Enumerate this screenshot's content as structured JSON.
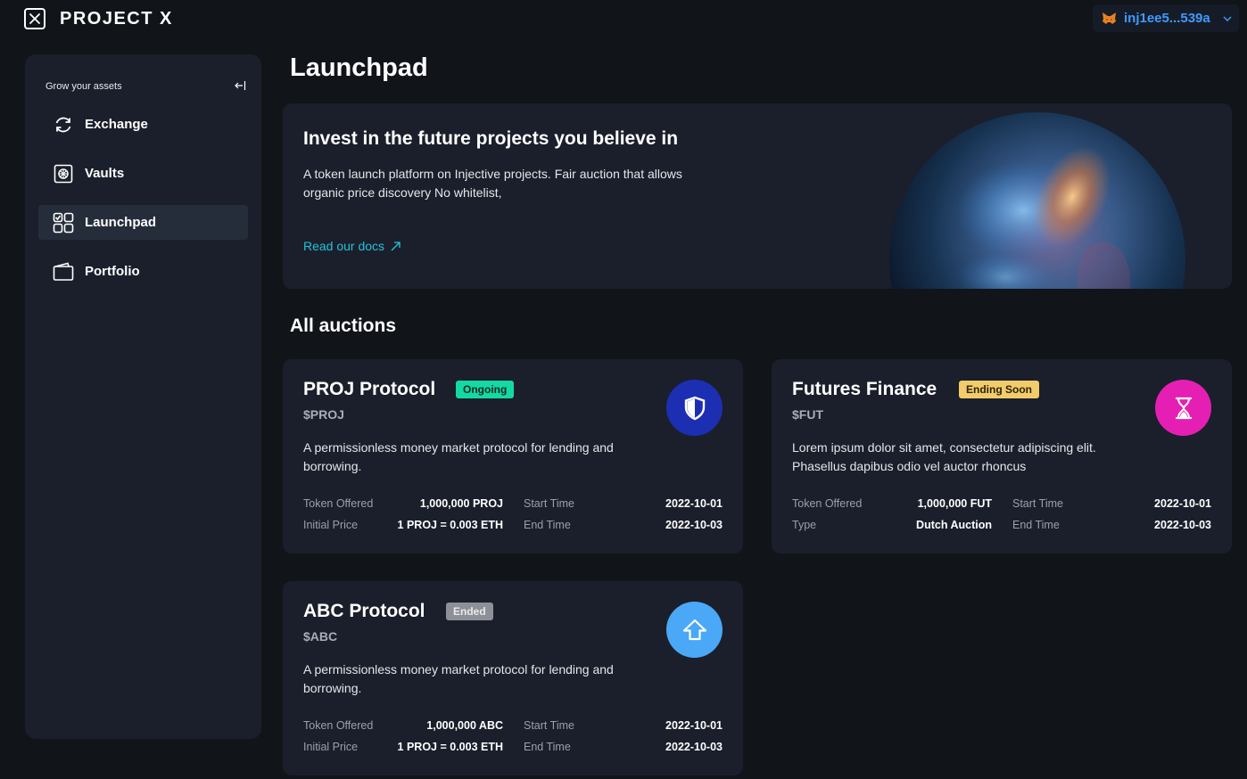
{
  "app": {
    "brand": "PROJECT X",
    "wallet_address": "inj1ee5...539a"
  },
  "sidebar": {
    "heading": "Grow your assets",
    "items": [
      {
        "label": "Exchange",
        "icon": "exchange-icon",
        "active": false
      },
      {
        "label": "Vaults",
        "icon": "vault-icon",
        "active": false
      },
      {
        "label": "Launchpad",
        "icon": "launchpad-icon",
        "active": true
      },
      {
        "label": "Portfolio",
        "icon": "wallet-icon",
        "active": false
      }
    ]
  },
  "main": {
    "title": "Launchpad",
    "hero": {
      "title": "Invest in the future projects you believe in",
      "description": "A token launch platform on Injective projects. Fair auction that allows organic price discovery No whitelist,",
      "link_label": "Read our docs"
    },
    "auctions_title": "All auctions",
    "auctions": [
      {
        "name": "PROJ Protocol",
        "badge": "Ongoing",
        "ticker": "$PROJ",
        "description": "A permissionless money market protocol for lending and borrowing.",
        "icon": "shield-icon",
        "icon_color": "#1c2fb3",
        "row1_label": "Token Offered",
        "row1_value": "1,000,000 PROJ",
        "row2_label": "Initial Price",
        "row2_value": "1 PROJ = 0.003 ETH",
        "start_label": "Start Time",
        "start_value": "2022-10-01",
        "end_label": "End Time",
        "end_value": "2022-10-03"
      },
      {
        "name": "Futures Finance",
        "badge": "Ending Soon",
        "ticker": "$FUT",
        "description": "Lorem ipsum dolor sit amet, consectetur adipiscing elit. Phasellus dapibus odio vel auctor rhoncus",
        "icon": "hourglass-icon",
        "icon_color": "#e61fb4",
        "row1_label": "Token Offered",
        "row1_value": "1,000,000 FUT",
        "row2_label": "Type",
        "row2_value": "Dutch Auction",
        "start_label": "Start Time",
        "start_value": "2022-10-01",
        "end_label": "End Time",
        "end_value": "2022-10-03"
      },
      {
        "name": "ABC Protocol",
        "badge": "Ended",
        "ticker": "$ABC",
        "description": "A permissionless money market protocol for lending and borrowing.",
        "icon": "arrow-up-icon",
        "icon_color": "#4aa8f6",
        "row1_label": "Token Offered",
        "row1_value": "1,000,000 ABC",
        "row2_label": "Initial Price",
        "row2_value": "1 PROJ = 0.003 ETH",
        "start_label": "Start Time",
        "start_value": "2022-10-01",
        "end_label": "End Time",
        "end_value": "2022-10-03"
      }
    ]
  }
}
